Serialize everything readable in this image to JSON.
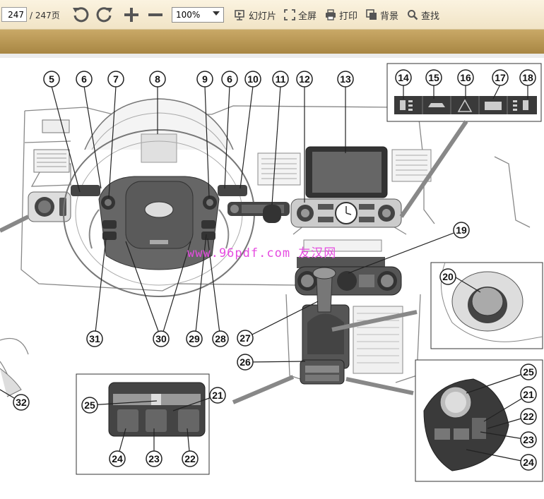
{
  "toolbar": {
    "page_current": "247",
    "page_total": "/ 247页",
    "zoom_value": "100%",
    "slideshow_label": "幻灯片",
    "fullscreen_label": "全屏",
    "print_label": "打印",
    "background_label": "背景",
    "search_label": "查找"
  },
  "watermark": "www.96pdf.com 友汉网",
  "callouts": [
    "5",
    "6",
    "7",
    "8",
    "9",
    "6",
    "10",
    "11",
    "12",
    "13",
    "14",
    "15",
    "16",
    "17",
    "18",
    "19",
    "20",
    "21",
    "22",
    "23",
    "24",
    "25",
    "26",
    "27",
    "28",
    "29",
    "30",
    "31",
    "32",
    "25",
    "21",
    "22",
    "23",
    "24",
    "25",
    "21",
    "22",
    "23",
    "24"
  ]
}
